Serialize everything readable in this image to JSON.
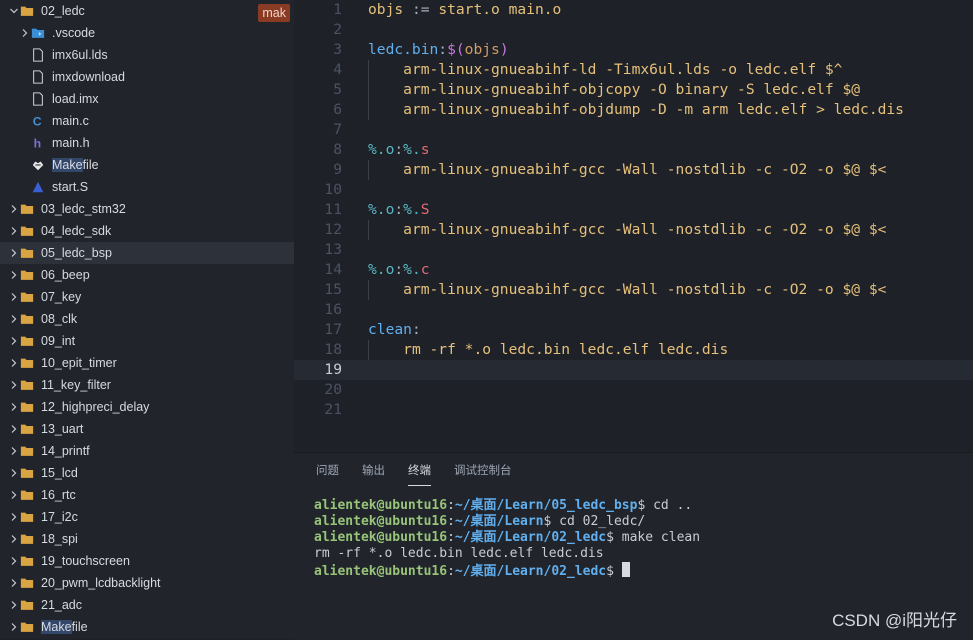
{
  "sidebar": {
    "items": [
      {
        "label": "02_ledc",
        "type": "folder-open",
        "depth": 0,
        "chevron": "down"
      },
      {
        "label": ".vscode",
        "type": "vscode-folder",
        "depth": 1,
        "chevron": "right"
      },
      {
        "label": "imx6ul.lds",
        "type": "file",
        "depth": 1
      },
      {
        "label": "imxdownload",
        "type": "file",
        "depth": 1
      },
      {
        "label": "load.imx",
        "type": "file",
        "depth": 1
      },
      {
        "label": "main.c",
        "type": "c-file",
        "depth": 1
      },
      {
        "label": "main.h",
        "type": "h-file",
        "depth": 1
      },
      {
        "label_hl": "Make",
        "label": "file",
        "type": "makefile",
        "depth": 1
      },
      {
        "label": "start.S",
        "type": "asm-file",
        "depth": 1
      },
      {
        "label": "03_ledc_stm32",
        "type": "folder",
        "depth": 0,
        "chevron": "right"
      },
      {
        "label": "04_ledc_sdk",
        "type": "folder",
        "depth": 0,
        "chevron": "right"
      },
      {
        "label": "05_ledc_bsp",
        "type": "folder",
        "depth": 0,
        "chevron": "right",
        "selected": true
      },
      {
        "label": "06_beep",
        "type": "folder",
        "depth": 0,
        "chevron": "right"
      },
      {
        "label": "07_key",
        "type": "folder",
        "depth": 0,
        "chevron": "right"
      },
      {
        "label": "08_clk",
        "type": "folder",
        "depth": 0,
        "chevron": "right"
      },
      {
        "label": "09_int",
        "type": "folder",
        "depth": 0,
        "chevron": "right"
      },
      {
        "label": "10_epit_timer",
        "type": "folder",
        "depth": 0,
        "chevron": "right"
      },
      {
        "label": "11_key_filter",
        "type": "folder",
        "depth": 0,
        "chevron": "right"
      },
      {
        "label": "12_highpreci_delay",
        "type": "folder",
        "depth": 0,
        "chevron": "right"
      },
      {
        "label": "13_uart",
        "type": "folder",
        "depth": 0,
        "chevron": "right"
      },
      {
        "label": "14_printf",
        "type": "folder",
        "depth": 0,
        "chevron": "right"
      },
      {
        "label": "15_lcd",
        "type": "folder",
        "depth": 0,
        "chevron": "right"
      },
      {
        "label": "16_rtc",
        "type": "folder",
        "depth": 0,
        "chevron": "right"
      },
      {
        "label": "17_i2c",
        "type": "folder",
        "depth": 0,
        "chevron": "right"
      },
      {
        "label": "18_spi",
        "type": "folder",
        "depth": 0,
        "chevron": "right"
      },
      {
        "label": "19_touchscreen",
        "type": "folder",
        "depth": 0,
        "chevron": "right"
      },
      {
        "label": "20_pwm_lcdbacklight",
        "type": "folder",
        "depth": 0,
        "chevron": "right"
      },
      {
        "label": "21_adc",
        "type": "folder",
        "depth": 0,
        "chevron": "right"
      },
      {
        "label_hl": "Make",
        "label": "file",
        "type": "folder",
        "depth": 0,
        "chevron": "right"
      }
    ],
    "badge": "mak"
  },
  "editor": {
    "current_line": 19,
    "lines": [
      {
        "n": "1",
        "tokens": [
          [
            "t-var",
            "objs"
          ],
          [
            "t-op",
            " := "
          ],
          [
            "t-var",
            "start.o main.o"
          ]
        ]
      },
      {
        "n": "2",
        "tokens": []
      },
      {
        "n": "3",
        "tokens": [
          [
            "t-tgt",
            "ledc.bin"
          ],
          [
            "t-op",
            ":"
          ],
          [
            "t-fn",
            "$("
          ],
          [
            "t-paren",
            "objs"
          ],
          [
            "t-fn",
            ")"
          ]
        ]
      },
      {
        "n": "4",
        "tokens": [
          [
            "t-op",
            "    "
          ],
          [
            "t-cmd",
            "arm-linux-gnueabihf-ld -Timx6ul.lds -o ledc.elf $^"
          ]
        ]
      },
      {
        "n": "5",
        "tokens": [
          [
            "t-op",
            "    "
          ],
          [
            "t-cmd",
            "arm-linux-gnueabihf-objcopy -O binary -S ledc.elf $@"
          ]
        ]
      },
      {
        "n": "6",
        "tokens": [
          [
            "t-op",
            "    "
          ],
          [
            "t-cmd",
            "arm-linux-gnueabihf-objdump -D -m arm ledc.elf > ledc.dis"
          ]
        ]
      },
      {
        "n": "7",
        "tokens": []
      },
      {
        "n": "8",
        "tokens": [
          [
            "t-pct",
            "%.o"
          ],
          [
            "t-op",
            ":"
          ],
          [
            "t-pct",
            "%."
          ],
          [
            "t-ext",
            "s"
          ]
        ]
      },
      {
        "n": "9",
        "tokens": [
          [
            "t-op",
            "    "
          ],
          [
            "t-cmd",
            "arm-linux-gnueabihf-gcc -Wall -nostdlib -c -O2 -o $@ $<"
          ]
        ]
      },
      {
        "n": "10",
        "tokens": []
      },
      {
        "n": "11",
        "tokens": [
          [
            "t-pct",
            "%.o"
          ],
          [
            "t-op",
            ":"
          ],
          [
            "t-pct",
            "%."
          ],
          [
            "t-ext",
            "S"
          ]
        ]
      },
      {
        "n": "12",
        "tokens": [
          [
            "t-op",
            "    "
          ],
          [
            "t-cmd",
            "arm-linux-gnueabihf-gcc -Wall -nostdlib -c -O2 -o $@ $<"
          ]
        ]
      },
      {
        "n": "13",
        "tokens": []
      },
      {
        "n": "14",
        "tokens": [
          [
            "t-pct",
            "%.o"
          ],
          [
            "t-op",
            ":"
          ],
          [
            "t-pct",
            "%."
          ],
          [
            "t-ext",
            "c"
          ]
        ]
      },
      {
        "n": "15",
        "tokens": [
          [
            "t-op",
            "    "
          ],
          [
            "t-cmd",
            "arm-linux-gnueabihf-gcc -Wall -nostdlib -c -O2 -o $@ $<"
          ]
        ]
      },
      {
        "n": "16",
        "tokens": []
      },
      {
        "n": "17",
        "tokens": [
          [
            "t-tgt",
            "clean"
          ],
          [
            "t-op",
            ":"
          ]
        ]
      },
      {
        "n": "18",
        "tokens": [
          [
            "t-op",
            "    "
          ],
          [
            "t-rm",
            "rm -rf *.o ledc.bin ledc.elf ledc.dis"
          ]
        ]
      },
      {
        "n": "19",
        "tokens": []
      },
      {
        "n": "20",
        "tokens": []
      },
      {
        "n": "21",
        "tokens": []
      }
    ]
  },
  "panel": {
    "tabs": [
      {
        "label": "问题"
      },
      {
        "label": "输出"
      },
      {
        "label": "终端",
        "active": true
      },
      {
        "label": "调试控制台"
      }
    ],
    "terminal": [
      {
        "user": "alientek@ubuntu16",
        "path": "~/桌面/Learn/05_ledc_bsp",
        "cmd": "$ cd .."
      },
      {
        "user": "alientek@ubuntu16",
        "path": "~/桌面/Learn",
        "cmd": "$ cd 02_ledc/"
      },
      {
        "user": "alientek@ubuntu16",
        "path": "~/桌面/Learn/02_ledc",
        "cmd": "$ make clean"
      },
      {
        "output": "rm -rf *.o ledc.bin ledc.elf ledc.dis"
      },
      {
        "user": "alientek@ubuntu16",
        "path": "~/桌面/Learn/02_ledc",
        "cmd": "$ ",
        "cursor": true
      }
    ]
  },
  "watermark": "CSDN @i阳光仔",
  "colors": {
    "folder": "#d9a441",
    "c_icon": "#3f8fd6",
    "h_icon": "#7c6fd6",
    "badge_bg": "#8a3b24"
  }
}
